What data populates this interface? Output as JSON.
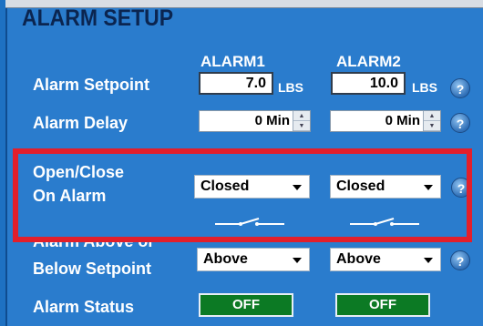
{
  "title": "ALARM SETUP",
  "columns": {
    "alarm1": "ALARM1",
    "alarm2": "ALARM2"
  },
  "setpoint": {
    "label": "Alarm Setpoint",
    "alarm1_value": "7.0",
    "alarm2_value": "10.0",
    "unit": "LBS"
  },
  "delay": {
    "label": "Alarm Delay",
    "alarm1_value": "0 Min",
    "alarm2_value": "0 Min"
  },
  "open_close": {
    "label_line1": "Open/Close",
    "label_line2": "On Alarm",
    "alarm1_value": "Closed",
    "alarm2_value": "Closed"
  },
  "above_below": {
    "label_line1": "Alarm Above or",
    "label_line2": "Below Setpoint",
    "alarm1_value": "Above",
    "alarm2_value": "Above"
  },
  "status": {
    "label": "Alarm Status",
    "alarm1_value": "OFF",
    "alarm2_value": "OFF"
  },
  "help_glyph": "?",
  "colors": {
    "panel": "#2a7ccd",
    "title": "#0b2550",
    "highlight": "#e21f2b",
    "status_off": "#0c7a24"
  }
}
